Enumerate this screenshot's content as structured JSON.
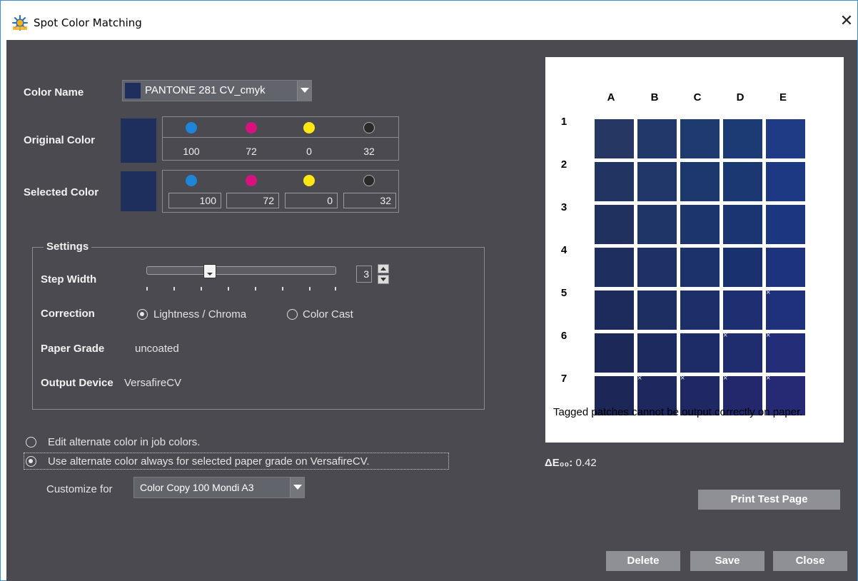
{
  "window": {
    "title": "Spot Color Matching",
    "close_glyph": "✕"
  },
  "color_name": {
    "label": "Color Name",
    "value": "PANTONE 281 CV_cmyk"
  },
  "original_color": {
    "label": "Original Color",
    "values": [
      "100",
      "72",
      "0",
      "32"
    ]
  },
  "selected_color": {
    "label": "Selected Color",
    "values": [
      "100",
      "72",
      "0",
      "32"
    ]
  },
  "ink_colors": {
    "cyan": "#1e86d8",
    "magenta": "#d8127c",
    "yellow": "#ffe812",
    "black": "#2a2a2a"
  },
  "settings": {
    "legend": "Settings",
    "step_width": {
      "label": "Step Width",
      "value": "3",
      "slider_fraction": 0.35
    },
    "correction": {
      "label": "Correction",
      "options": [
        "Lightness / Chroma",
        "Color Cast"
      ],
      "selected": "Lightness / Chroma"
    },
    "paper_grade": {
      "label": "Paper Grade",
      "value": "uncoated"
    },
    "output_device": {
      "label": "Output Device",
      "value": "VersafireCV"
    }
  },
  "alternate": {
    "option_edit": "Edit alternate color in job colors.",
    "option_use": "Use alternate color always for selected paper grade on VersafireCV.",
    "selected": "use",
    "customize_label": "Customize for",
    "customize_value": "Color Copy 100 Mondi A3"
  },
  "grid": {
    "columns": [
      "A",
      "B",
      "C",
      "D",
      "E"
    ],
    "rows": [
      "1",
      "2",
      "3",
      "4",
      "5",
      "6",
      "7"
    ],
    "tag_glyph": "×",
    "note": "Tagged patches cannot be output correctly on paper.",
    "patches": [
      [
        "#253762",
        "#23386a",
        "#1f3a6e",
        "#1c3b74",
        "#1f3b86"
      ],
      [
        "#223461",
        "#213769",
        "#1d386d",
        "#1b3873",
        "#1d3983"
      ],
      [
        "#203160",
        "#1f3467",
        "#1c366d",
        "#1a3572",
        "#1c3780"
      ],
      [
        "#1e2e5e",
        "#1d3166",
        "#1c326b",
        "#1a3170",
        "#1d337e"
      ],
      [
        "#1c2b5b",
        "#1c2e62",
        "#1c2f69",
        "#1d2f70",
        "#20317c"
      ],
      [
        "#1b2858",
        "#1c2a60",
        "#1d2c66",
        "#1f2c6e",
        "#232d78"
      ],
      [
        "#1d2757",
        "#1f285e",
        "#202864",
        "#22286b",
        "#262a75"
      ]
    ],
    "tagged": [
      [
        4,
        4
      ],
      [
        5,
        3
      ],
      [
        5,
        4
      ],
      [
        6,
        1
      ],
      [
        6,
        2
      ],
      [
        6,
        3
      ],
      [
        6,
        4
      ]
    ]
  },
  "delta_e": {
    "label": "ΔE₀₀:",
    "value": "0.42"
  },
  "buttons": {
    "print_test_page": "Print Test Page",
    "delete": "Delete",
    "save": "Save",
    "close": "Close"
  },
  "swatch_color": "#1e2f5e"
}
